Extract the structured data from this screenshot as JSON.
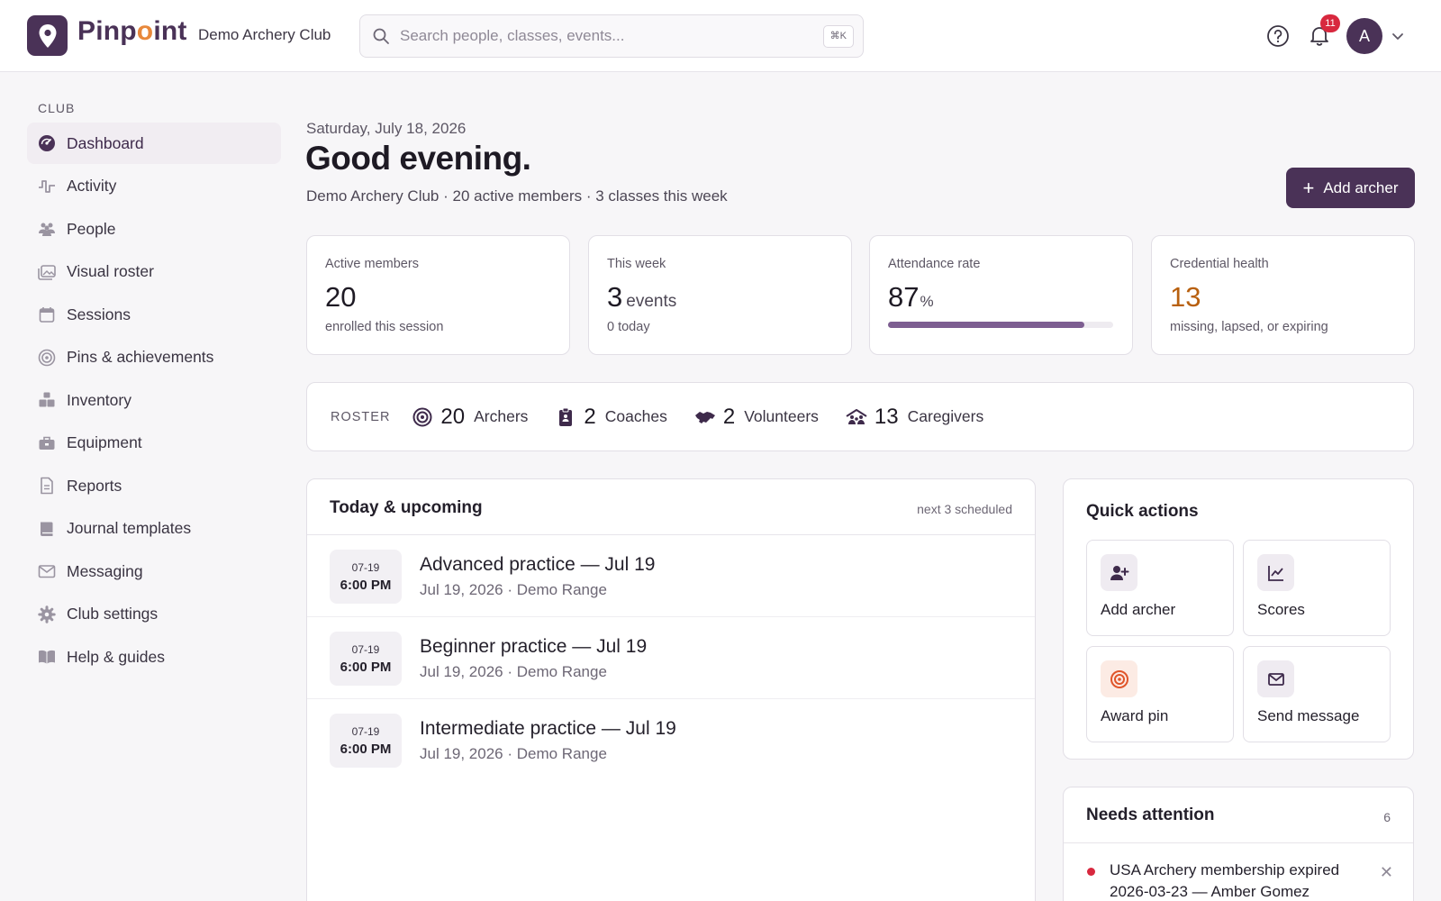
{
  "app": {
    "brand_pre": "Pinp",
    "brand_dot": "o",
    "brand_post": "int",
    "club": "Demo Archery Club"
  },
  "search": {
    "placeholder": "Search people, classes, events...",
    "shortcut": "⌘K"
  },
  "header": {
    "notifications": "11",
    "avatar_initial": "A"
  },
  "sidebar": {
    "section": "CLUB",
    "items": [
      {
        "label": "Dashboard",
        "icon": "dashboard-icon",
        "active": true
      },
      {
        "label": "Activity",
        "icon": "activity-icon"
      },
      {
        "label": "People",
        "icon": "people-icon"
      },
      {
        "label": "Visual roster",
        "icon": "photos-icon"
      },
      {
        "label": "Sessions",
        "icon": "calendar-icon"
      },
      {
        "label": "Pins & achievements",
        "icon": "target-icon"
      },
      {
        "label": "Inventory",
        "icon": "boxes-icon"
      },
      {
        "label": "Equipment",
        "icon": "toolbox-icon"
      },
      {
        "label": "Reports",
        "icon": "document-icon"
      },
      {
        "label": "Journal templates",
        "icon": "book-icon"
      },
      {
        "label": "Messaging",
        "icon": "envelope-icon"
      },
      {
        "label": "Club settings",
        "icon": "gear-icon"
      },
      {
        "label": "Help & guides",
        "icon": "open-book-icon"
      }
    ]
  },
  "main": {
    "date": "Saturday, July 18, 2026",
    "greeting": "Good evening.",
    "subline": "Demo Archery Club · 20 active members · 3 classes this week",
    "add_button": "Add archer"
  },
  "stats": [
    {
      "key": "Active members",
      "value": "20",
      "unit": "",
      "note": "enrolled this session"
    },
    {
      "key": "This week",
      "value": "3",
      "unit": "events",
      "note": "0 today"
    },
    {
      "key": "Attendance rate",
      "value": "87",
      "unit": "%",
      "progress": 0.87
    },
    {
      "key": "Credential health",
      "value": "13",
      "unit": "",
      "note": "missing, lapsed, or expiring",
      "color": "#b8600f"
    }
  ],
  "roster": {
    "label": "ROSTER",
    "groups": [
      {
        "count": "20",
        "name": "Archers",
        "icon": "target-icon"
      },
      {
        "count": "2",
        "name": "Coaches",
        "icon": "clipboard-icon"
      },
      {
        "count": "2",
        "name": "Volunteers",
        "icon": "handshake-icon"
      },
      {
        "count": "13",
        "name": "Caregivers",
        "icon": "family-icon"
      }
    ]
  },
  "upcoming": {
    "title": "Today & upcoming",
    "meta": "next 3 scheduled",
    "events": [
      {
        "date": "07-19",
        "time": "6:00 PM",
        "title": "Advanced practice — Jul 19",
        "sub": "Jul 19, 2026 · Demo Range"
      },
      {
        "date": "07-19",
        "time": "6:00 PM",
        "title": "Beginner practice — Jul 19",
        "sub": "Jul 19, 2026 · Demo Range"
      },
      {
        "date": "07-19",
        "time": "6:00 PM",
        "title": "Intermediate practice — Jul 19",
        "sub": "Jul 19, 2026 · Demo Range"
      }
    ]
  },
  "quick": {
    "title": "Quick actions",
    "tiles": [
      {
        "label": "Add archer",
        "icon": "user-plus-icon"
      },
      {
        "label": "Scores",
        "icon": "chart-icon"
      },
      {
        "label": "Award pin",
        "icon": "target-icon"
      },
      {
        "label": "Send message",
        "icon": "envelope-icon"
      }
    ]
  },
  "attention": {
    "title": "Needs attention",
    "count": "6",
    "items": [
      {
        "text": "USA Archery membership expired 2026-03-23 — Amber Gomez"
      }
    ]
  },
  "colors": {
    "primary": "#4a3257",
    "accent": "#e8883b",
    "warn": "#b8600f",
    "alert": "#d8283e"
  }
}
